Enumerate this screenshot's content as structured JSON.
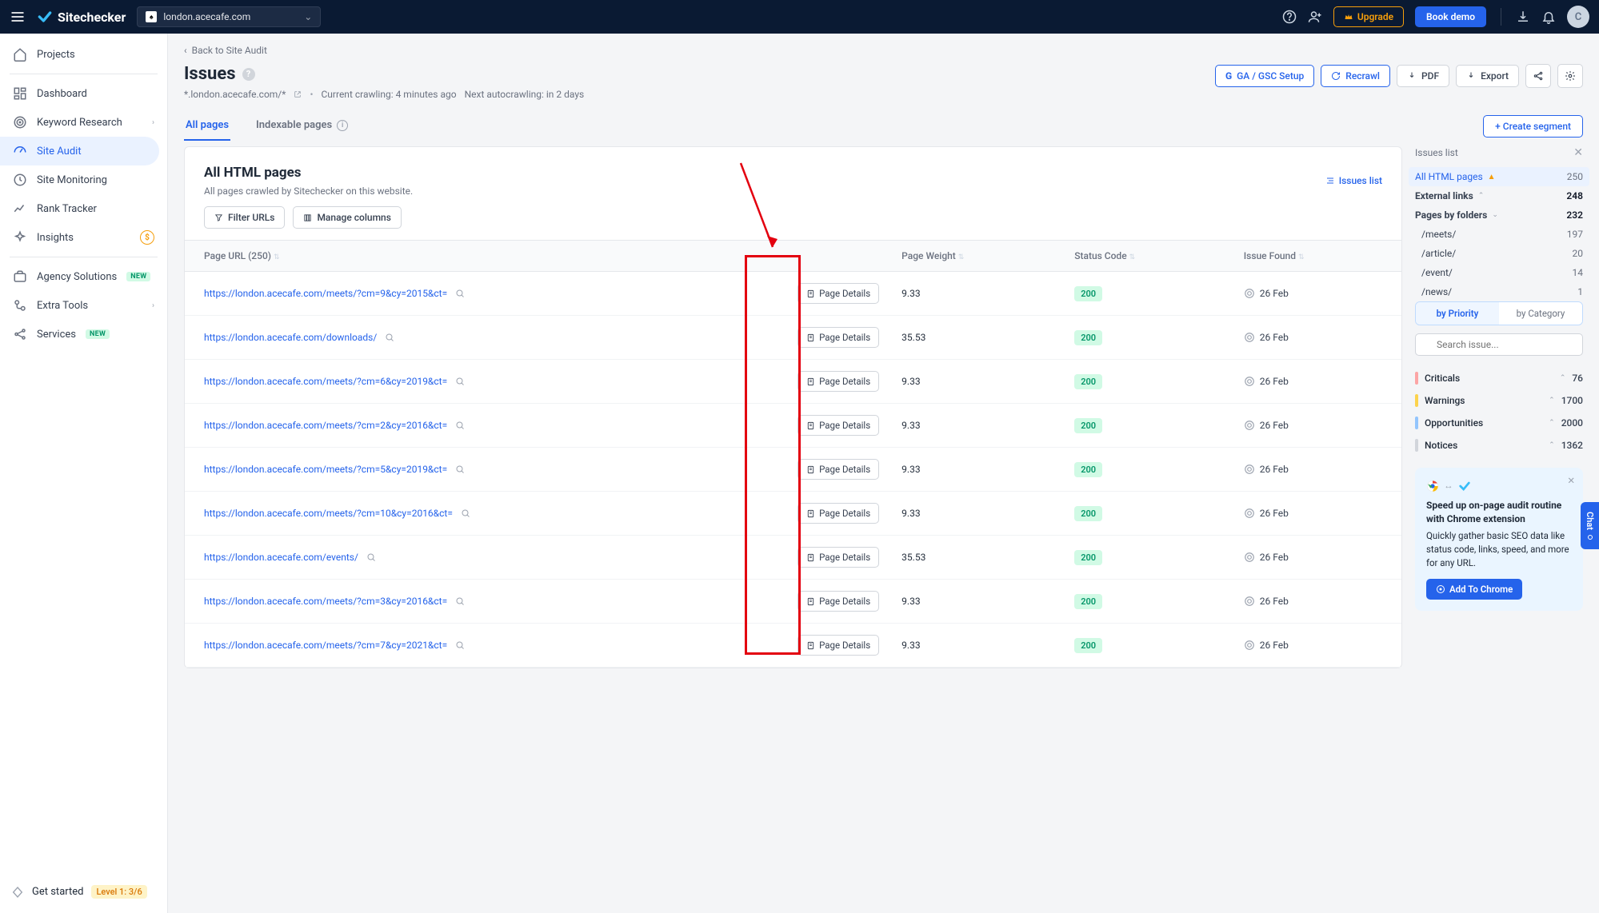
{
  "top": {
    "brand": "Sitechecker",
    "domain": "london.acecafe.com",
    "upgrade": "Upgrade",
    "book_demo": "Book demo",
    "avatar_letter": "C"
  },
  "sidebar": {
    "projects": "Projects",
    "items": [
      {
        "label": "Dashboard"
      },
      {
        "label": "Keyword Research",
        "chev": true
      },
      {
        "label": "Site Audit",
        "active": true
      },
      {
        "label": "Site Monitoring"
      },
      {
        "label": "Rank Tracker"
      },
      {
        "label": "Insights",
        "dollar": true
      }
    ],
    "items2": [
      {
        "label": "Agency Solutions",
        "new": true
      },
      {
        "label": "Extra Tools",
        "chev": true
      },
      {
        "label": "Services",
        "new": true
      }
    ],
    "get_started": "Get started",
    "level": "Level 1: 3/6"
  },
  "page": {
    "back": "Back to Site Audit",
    "title": "Issues",
    "scope": "*.london.acecafe.com/*",
    "crawling": "Current crawling: 4 minutes ago",
    "next": "Next autocrawling: in 2 days",
    "tabs": {
      "all": "All pages",
      "indexable": "Indexable pages"
    },
    "create_segment": "+  Create segment",
    "actions": {
      "ga": "GA / GSC Setup",
      "recrawl": "Recrawl",
      "pdf": "PDF",
      "export": "Export"
    }
  },
  "card": {
    "title": "All HTML pages",
    "subtitle": "All pages crawled by Sitechecker on this website.",
    "issues_list": "Issues list",
    "filter": "Filter URLs",
    "manage": "Manage columns",
    "page_details": "Page Details",
    "headers": {
      "url": "Page URL (250)",
      "weight": "Page Weight",
      "status": "Status Code",
      "issue": "Issue Found"
    },
    "rows": [
      {
        "url": "https://london.acecafe.com/meets/?cm=9&cy=2015&ct=",
        "weight": "9.33",
        "status": "200",
        "date": "26 Feb"
      },
      {
        "url": "https://london.acecafe.com/downloads/",
        "weight": "35.53",
        "status": "200",
        "date": "26 Feb"
      },
      {
        "url": "https://london.acecafe.com/meets/?cm=6&cy=2019&ct=",
        "weight": "9.33",
        "status": "200",
        "date": "26 Feb"
      },
      {
        "url": "https://london.acecafe.com/meets/?cm=2&cy=2016&ct=",
        "weight": "9.33",
        "status": "200",
        "date": "26 Feb"
      },
      {
        "url": "https://london.acecafe.com/meets/?cm=5&cy=2019&ct=",
        "weight": "9.33",
        "status": "200",
        "date": "26 Feb"
      },
      {
        "url": "https://london.acecafe.com/meets/?cm=10&cy=2016&ct=",
        "weight": "9.33",
        "status": "200",
        "date": "26 Feb"
      },
      {
        "url": "https://london.acecafe.com/events/",
        "weight": "35.53",
        "status": "200",
        "date": "26 Feb"
      },
      {
        "url": "https://london.acecafe.com/meets/?cm=3&cy=2016&ct=",
        "weight": "9.33",
        "status": "200",
        "date": "26 Feb"
      },
      {
        "url": "https://london.acecafe.com/meets/?cm=7&cy=2021&ct=",
        "weight": "9.33",
        "status": "200",
        "date": "26 Feb"
      }
    ]
  },
  "right": {
    "title": "Issues list",
    "all_html": "All HTML pages",
    "all_html_count": "250",
    "external": "External links",
    "external_count": "248",
    "folders": "Pages by folders",
    "folders_count": "232",
    "folder_items": [
      {
        "name": "/meets/",
        "count": "197"
      },
      {
        "name": "/article/",
        "count": "20"
      },
      {
        "name": "/event/",
        "count": "14"
      },
      {
        "name": "/news/",
        "count": "1"
      }
    ],
    "by_priority": "by Priority",
    "by_category": "by Category",
    "search_ph": "Search issue...",
    "severities": [
      {
        "name": "Criticals",
        "count": "76",
        "cls": "crit"
      },
      {
        "name": "Warnings",
        "count": "1700",
        "cls": "warn"
      },
      {
        "name": "Opportunities",
        "count": "2000",
        "cls": "opp"
      },
      {
        "name": "Notices",
        "count": "1362",
        "cls": "not"
      }
    ],
    "promo_title": "Speed up on-page audit routine with Chrome extension",
    "promo_body": "Quickly gather basic SEO data like status code, links, speed, and more for any URL.",
    "promo_btn": "Add To Chrome"
  },
  "chat": "Chat"
}
